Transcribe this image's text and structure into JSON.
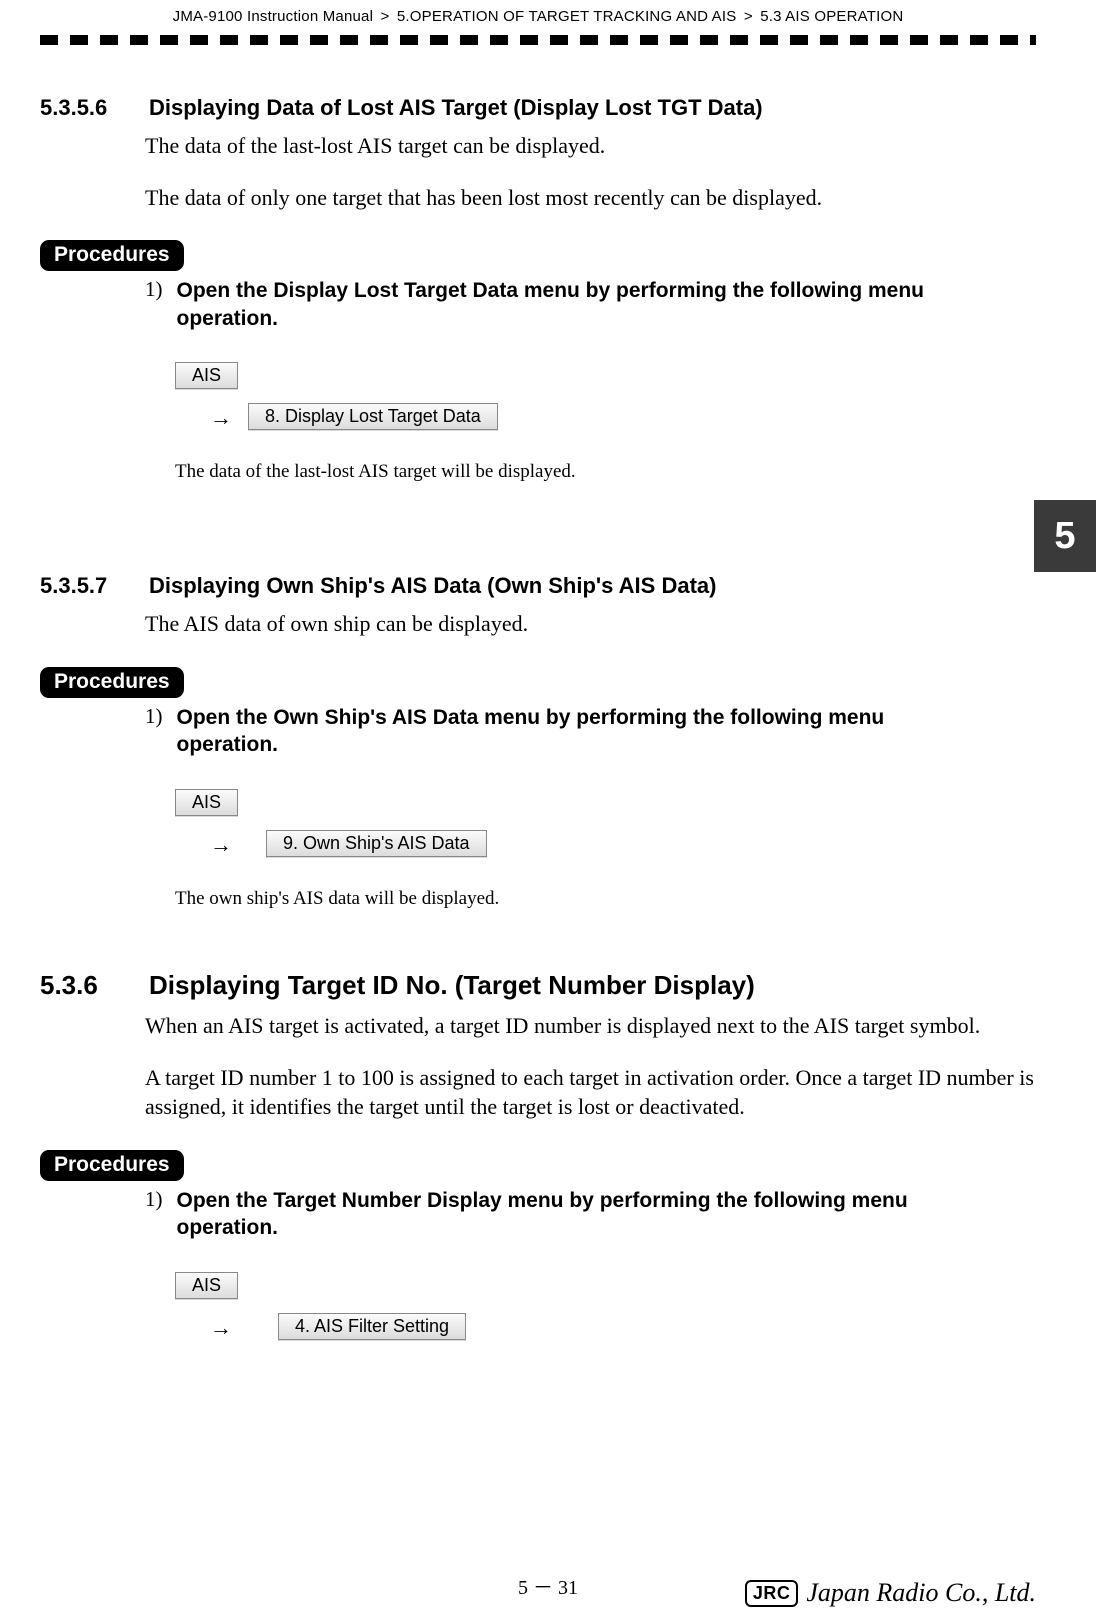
{
  "header": {
    "manual": "JMA-9100 Instruction Manual",
    "chapter": "5.OPERATION OF TARGET TRACKING AND AIS",
    "section": "5.3  AIS OPERATION",
    "sep": ">"
  },
  "chapter_tab": "5",
  "s53556": {
    "num": "5.3.5.6",
    "title": "Displaying Data of Lost AIS Target (Display Lost TGT Data)",
    "p1": "The data of the last-lost AIS target can be displayed.",
    "p2": "The data of only one target that has been lost most recently can be displayed.",
    "proc_label": "Procedures",
    "step_num": "1)",
    "step_text": "Open the Display Lost Target Data menu by performing the following menu operation.",
    "btn1": "AIS",
    "arrow": "→",
    "btn2": "8. Display Lost Target Data",
    "note": "The data of the last-lost AIS target will be displayed."
  },
  "s53557": {
    "num": "5.3.5.7",
    "title": "Displaying Own Ship's AIS Data  (Own Ship's AIS Data)",
    "p1": "The AIS data of own ship can be displayed.",
    "proc_label": "Procedures",
    "step_num": "1)",
    "step_text": "Open the Own Ship's AIS Data menu by performing the following menu operation.",
    "btn1": "AIS",
    "arrow": "→",
    "btn2": "9. Own Ship's AIS Data",
    "note": "The own ship's AIS data will be displayed."
  },
  "s536": {
    "num": "5.3.6",
    "title": "Displaying Target ID No. (Target Number Display)",
    "p1": "When an AIS target is activated, a target ID number is displayed next to the AIS target symbol.",
    "p2": "A target ID number 1 to 100 is assigned to each target in activation order. Once a target ID number is assigned, it identifies the target until the target is lost or deactivated.",
    "proc_label": "Procedures",
    "step_num": "1)",
    "step_text": "Open the Target Number Display menu by performing the following menu operation.",
    "btn1": "AIS",
    "arrow": "→",
    "btn2": "4. AIS Filter Setting"
  },
  "footer": {
    "page": "5 － 31",
    "logo_box": "JRC",
    "logo_script": "Japan Radio Co., Ltd."
  }
}
